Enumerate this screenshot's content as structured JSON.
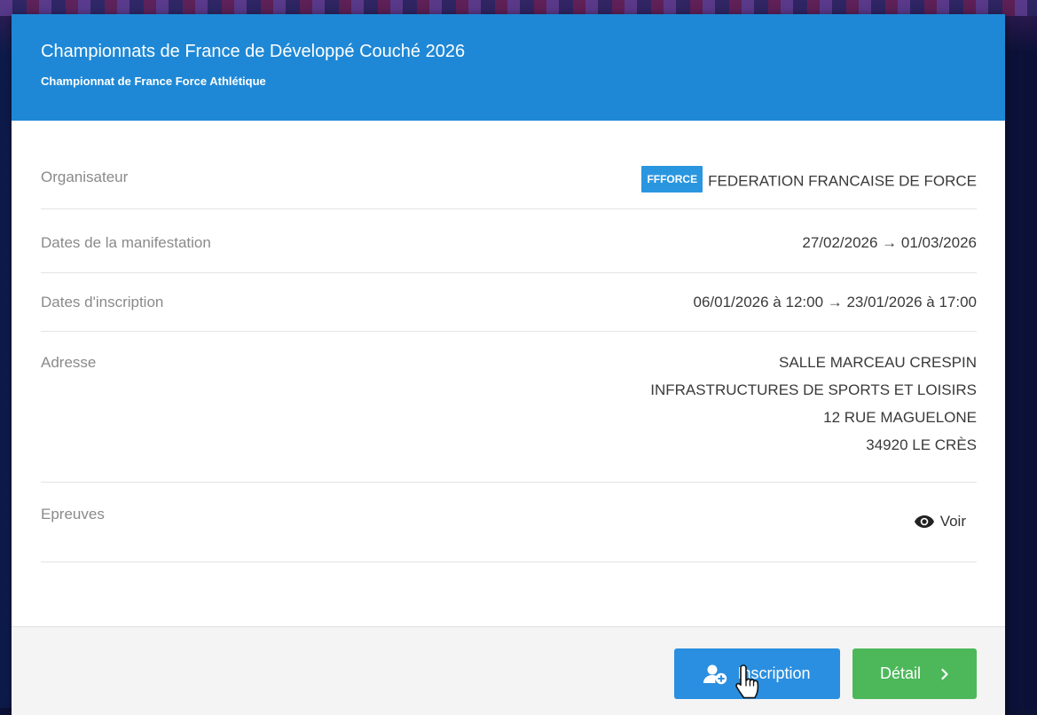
{
  "event": {
    "title": "Championnats de France de Développé Couché 2026",
    "subtitle": "Championnat de France Force Athlétique"
  },
  "details": {
    "organisateur": {
      "label": "Organisateur",
      "badge": "FFFORCE",
      "value": "FEDERATION FRANCAISE DE FORCE"
    },
    "dates_manifestation": {
      "label": "Dates de la manifestation",
      "value": "27/02/2026 → 01/03/2026"
    },
    "dates_inscription": {
      "label": "Dates d'inscription",
      "value": "06/01/2026 à 12:00 → 23/01/2026 à 17:00"
    },
    "adresse": {
      "label": "Adresse",
      "lines": [
        "SALLE MARCEAU CRESPIN",
        "INFRASTRUCTURES DE SPORTS ET LOISIRS",
        "12 RUE MAGUELONE",
        "34920 LE CRÈS"
      ]
    },
    "epreuves": {
      "label": "Epreuves",
      "action": "Voir",
      "icon": "eye-icon"
    }
  },
  "footer": {
    "inscription_label": "Inscription",
    "inscription_icon": "add-user-icon",
    "detail_label": "Détail",
    "detail_icon": "chevron-right-icon"
  },
  "colors": {
    "header": "#1e88d6",
    "badge": "#2a96e0",
    "inscription_button": "#2a8fe0",
    "detail_button": "#4cb85a"
  }
}
